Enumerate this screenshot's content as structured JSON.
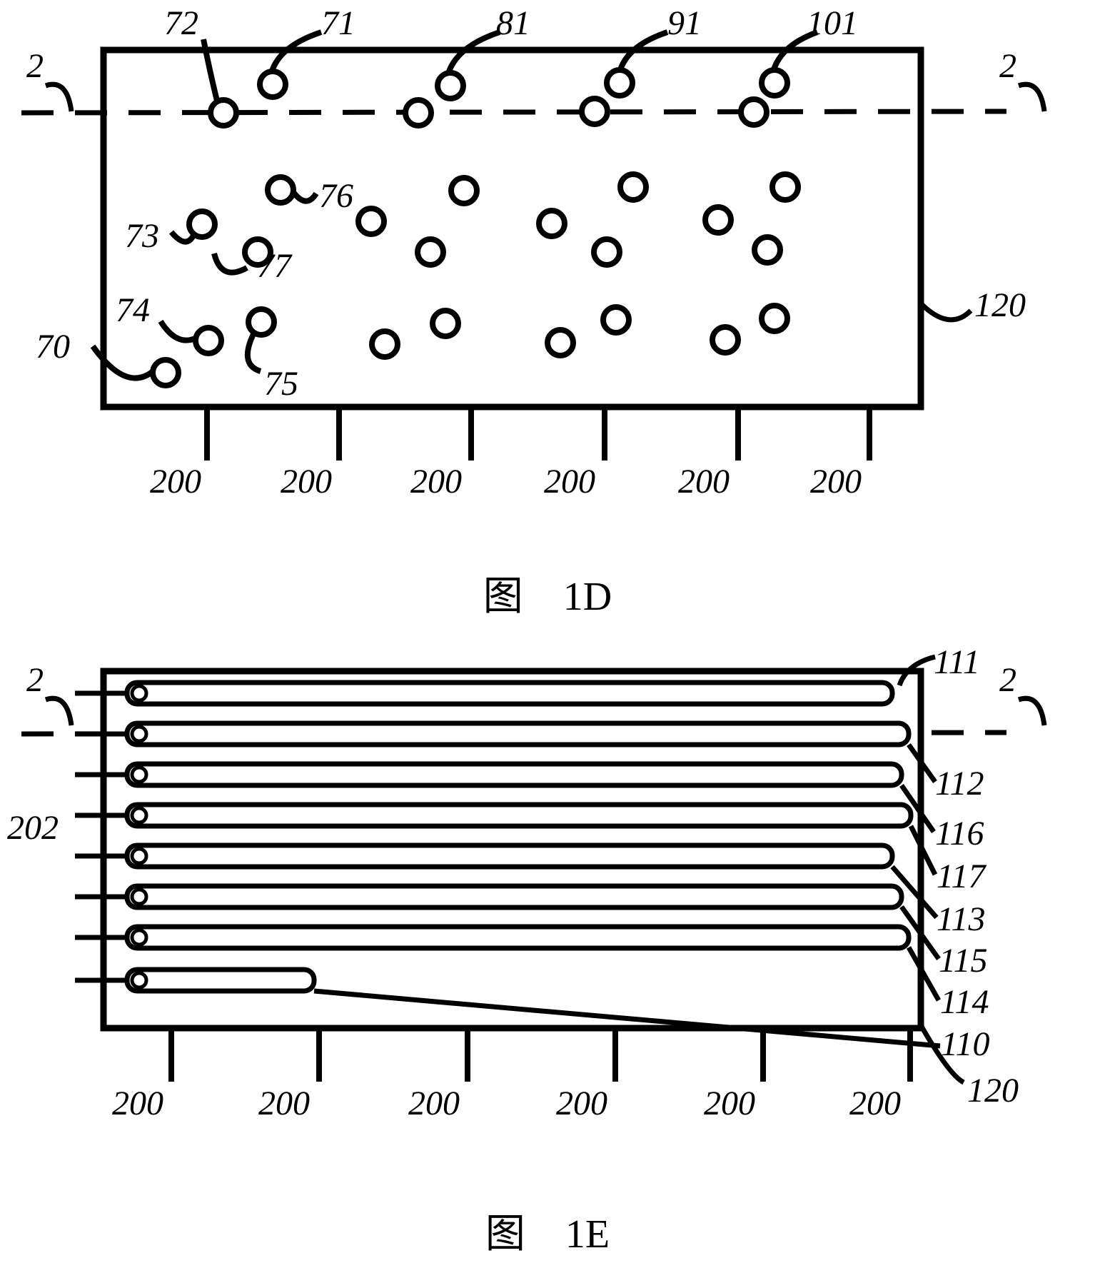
{
  "figure1D": {
    "caption_han": "图",
    "caption_num": "1D",
    "section_marker_left": "2",
    "section_marker_right": "2",
    "frame_label": "120",
    "callouts": {
      "c70": "70",
      "c71": "71",
      "c72": "72",
      "c73": "73",
      "c74": "74",
      "c75": "75",
      "c76": "76",
      "c77": "77",
      "c81": "81",
      "c91": "91",
      "c101": "101"
    },
    "axis_values": [
      "200",
      "200",
      "200",
      "200",
      "200",
      "200"
    ]
  },
  "figure1E": {
    "caption_han": "图",
    "caption_num": "1E",
    "section_marker_left": "2",
    "section_marker_right": "2",
    "left_label": "202",
    "callouts": {
      "c110": "110",
      "c111": "111",
      "c112": "112",
      "c113": "113",
      "c114": "114",
      "c115": "115",
      "c116": "116",
      "c117": "117",
      "c120": "120"
    },
    "axis_values": [
      "200",
      "200",
      "200",
      "200",
      "200",
      "200"
    ]
  }
}
